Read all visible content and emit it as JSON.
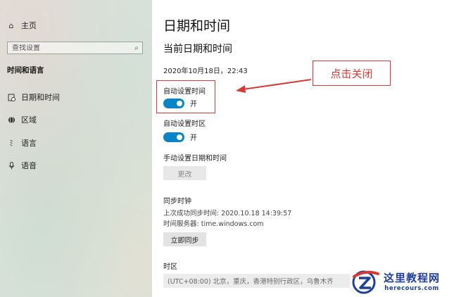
{
  "sidebar": {
    "home_label": "主页",
    "search_placeholder": "查找设置",
    "section_title": "时间和语言",
    "items": [
      {
        "label": "日期和时间",
        "icon": "calendar-clock-icon"
      },
      {
        "label": "区域",
        "icon": "globe-icon"
      },
      {
        "label": "语言",
        "icon": "language-icon"
      },
      {
        "label": "语音",
        "icon": "microphone-icon"
      }
    ]
  },
  "main": {
    "title": "日期和时间",
    "subtitle": "当前日期和时间",
    "current_datetime": "2020年10月18日，22:43",
    "auto_time": {
      "label": "自动设置时间",
      "state": "开"
    },
    "auto_timezone": {
      "label": "自动设置时区",
      "state": "开"
    },
    "manual_label": "手动设置日期和时间",
    "change_button": "更改",
    "sync_title": "同步时钟",
    "last_sync": "上次成功同步时间: 2020.10.18 14:39:57",
    "time_server": "时间服务器: time.windows.com",
    "sync_button": "立即同步",
    "timezone_title": "时区",
    "timezone_value": "(UTC+08:00) 北京，重庆，香港特别行政区，乌鲁木齐"
  },
  "annotation": {
    "callout_text": "点击关闭",
    "color": "#d63a36"
  },
  "watermark": {
    "cn": "这里教程网",
    "en": "herecours.com"
  },
  "colors": {
    "toggle_on": "#0a84c6",
    "brand_blue": "#1f3f9a"
  }
}
